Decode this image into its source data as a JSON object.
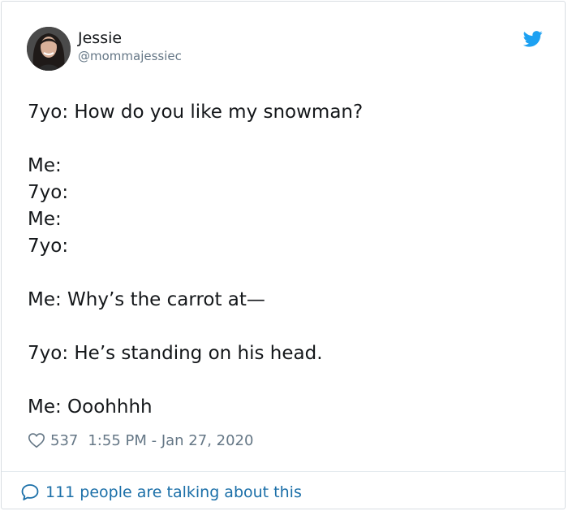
{
  "tweet": {
    "author": {
      "name": "Jessie",
      "handle": "@mommajessiec",
      "avatar_icon": "profile-photo"
    },
    "brand_icon": "twitter-bird-icon",
    "brand_color": "#1da1f2",
    "lines": [
      "7yo: How do you like my snowman?",
      "",
      "Me:",
      "7yo:",
      "Me:",
      "7yo:",
      "",
      "Me: Why’s the carrot at—",
      "",
      "7yo: He’s standing on his head.",
      "",
      "Me: Ooohhhh"
    ],
    "likes": "537",
    "timestamp": "1:55 PM - Jan 27, 2020",
    "conversation_link": "111 people are talking about this",
    "link_color": "#1b6fa8"
  }
}
